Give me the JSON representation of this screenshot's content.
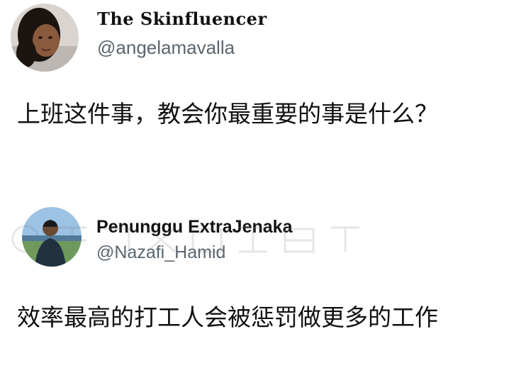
{
  "tweets": [
    {
      "author": {
        "display_name": "The Skinfluencer",
        "handle": "@angelamavalla",
        "avatar_icon": "profile-photo"
      },
      "text": "上班这件事，教会你最重要的事是什么？"
    },
    {
      "author": {
        "display_name": "Penunggu ExtraJenaka",
        "handle": "@Nazafi_Hamid",
        "avatar_icon": "profile-photo"
      },
      "text": "效率最高的打工人会被惩罚做更多的工作"
    }
  ],
  "colors": {
    "background": "#ffffff",
    "text": "#111111",
    "handle": "#5b6670"
  }
}
